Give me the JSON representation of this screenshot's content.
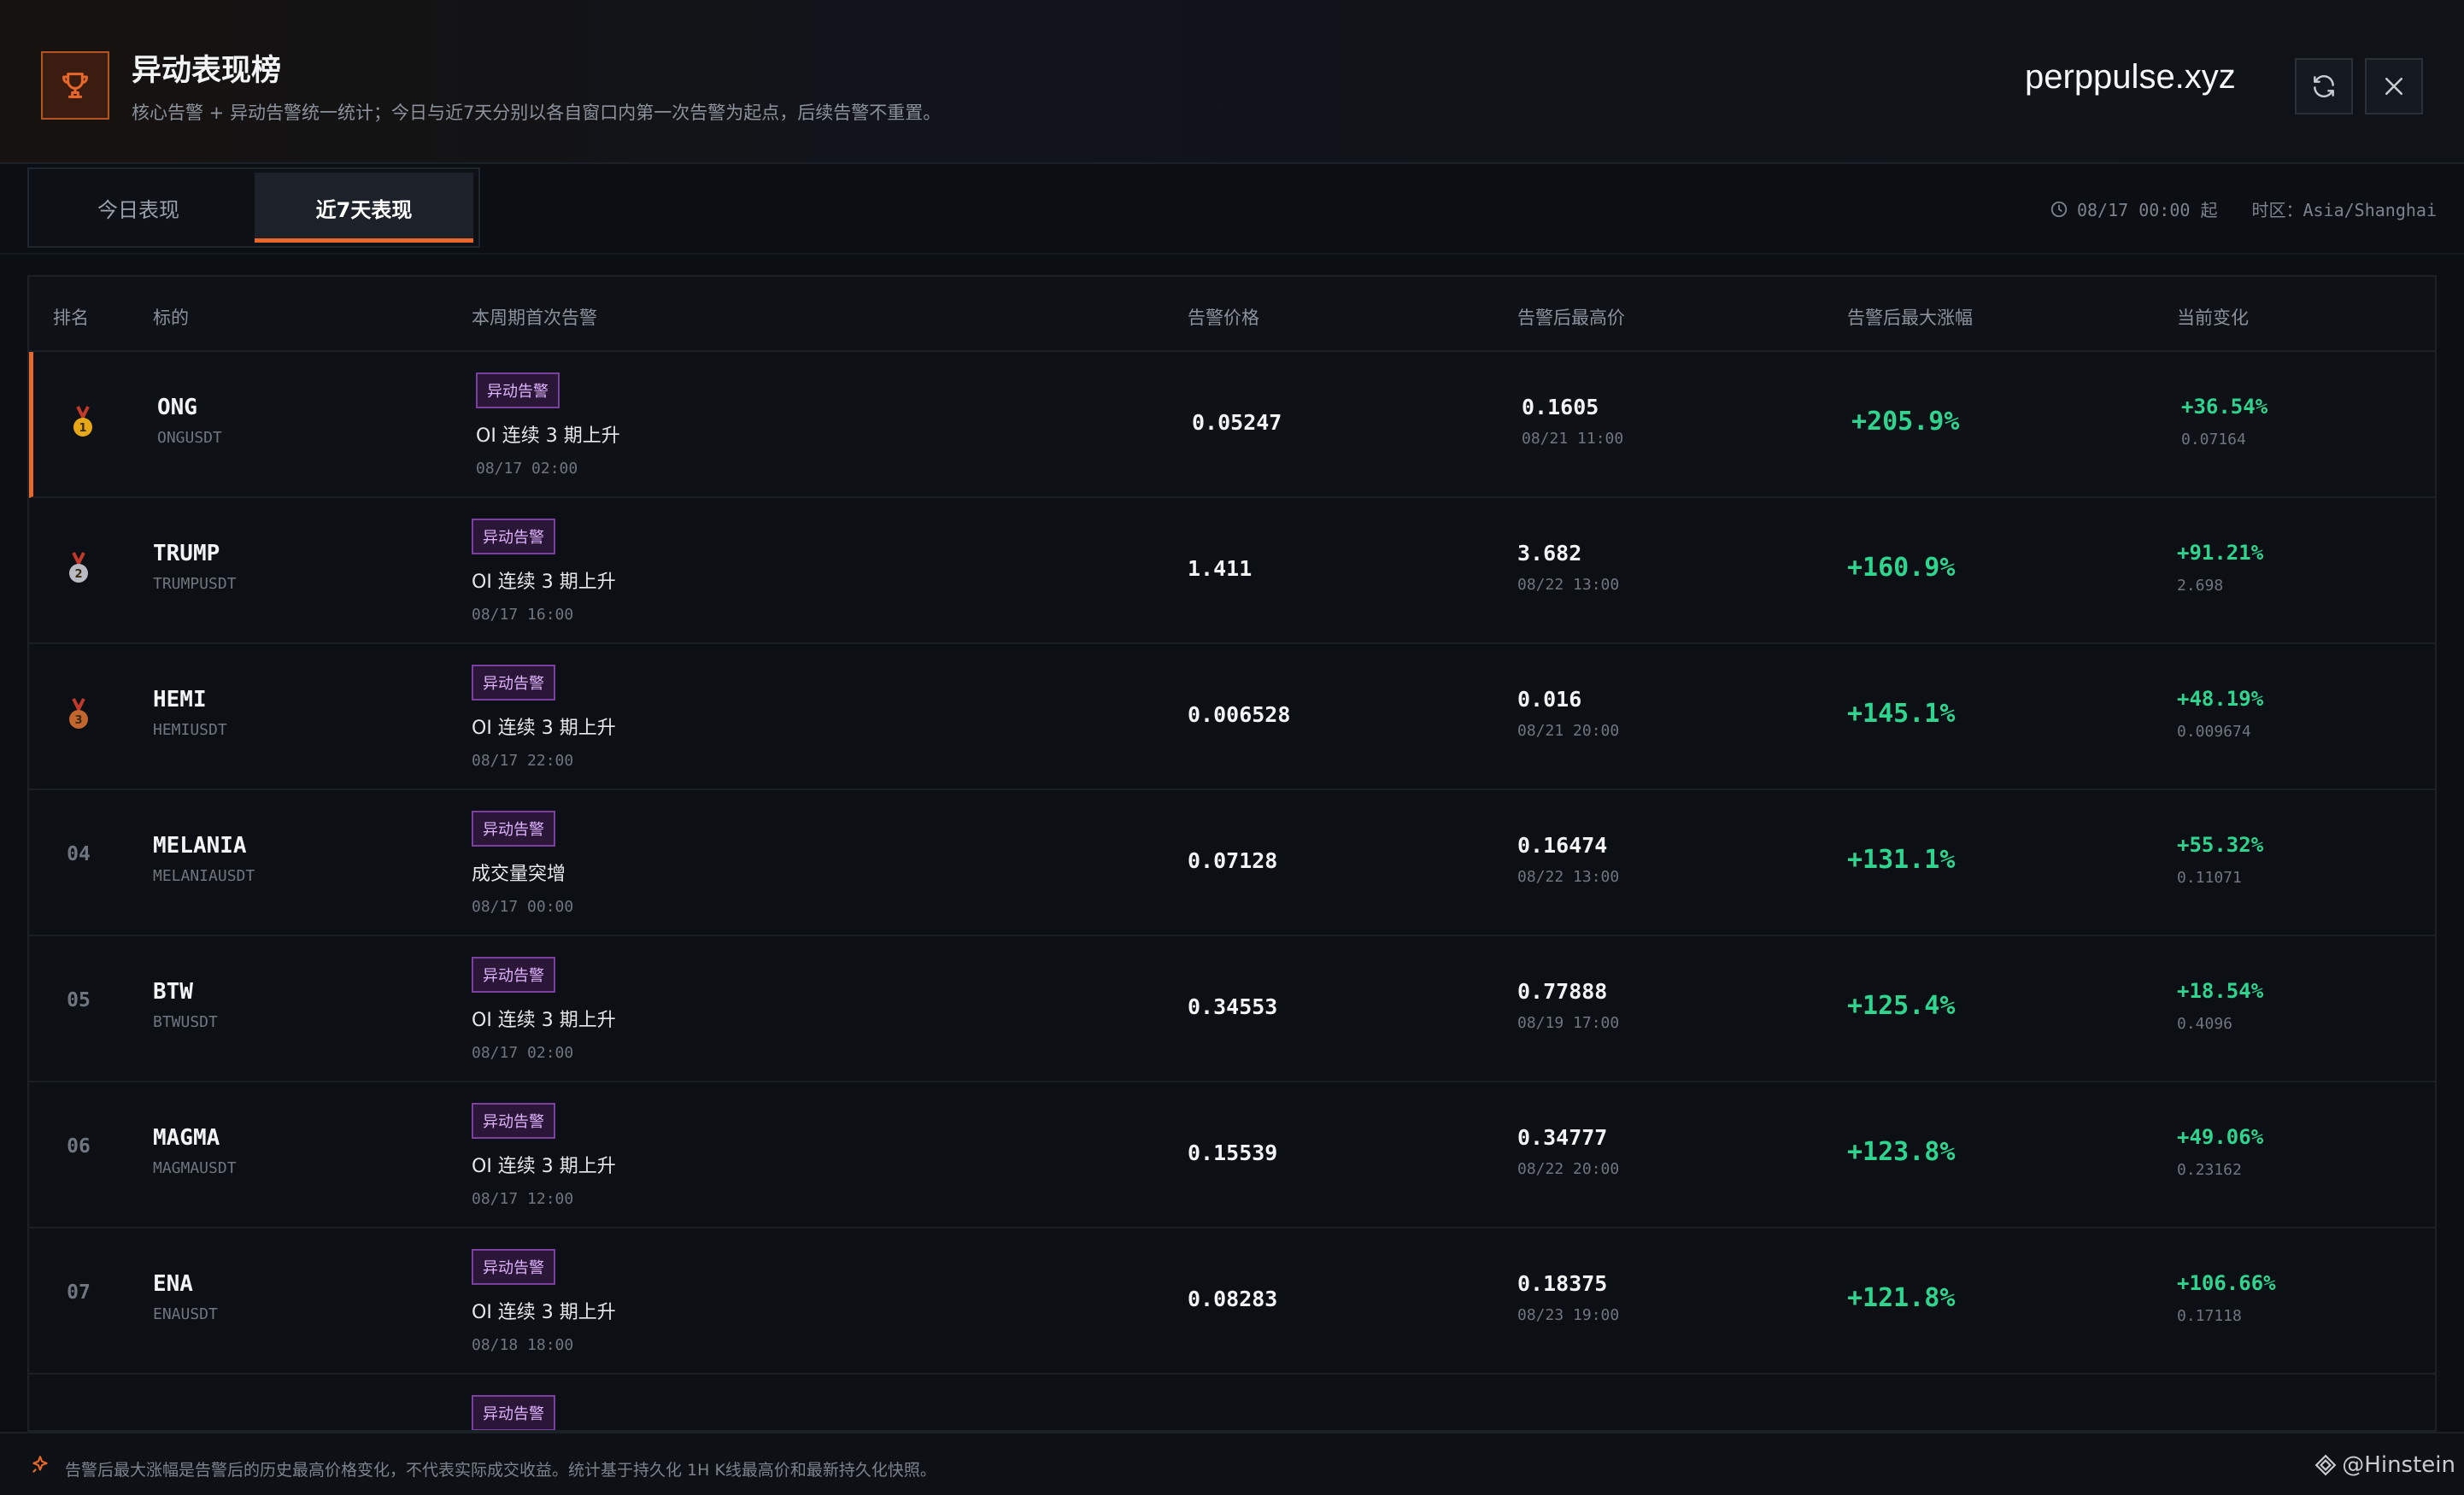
{
  "header": {
    "title": "异动表现榜",
    "subtitle": "核心告警 + 异动告警统一统计；今日与近7天分别以各自窗口内第一次告警为起点，后续告警不重置。",
    "brand": "perppulse.xyz",
    "icons": {
      "trophy": "trophy-icon",
      "refresh": "refresh-icon",
      "close": "close-icon"
    }
  },
  "tabs": [
    {
      "label": "今日表现",
      "active": false
    },
    {
      "label": "近7天表现",
      "active": true
    }
  ],
  "meta": {
    "since": "08/17 00:00 起",
    "timezone": "时区：Asia/Shanghai"
  },
  "columns": [
    "排名",
    "标的",
    "本周期首次告警",
    "告警价格",
    "告警后最高价",
    "告警后最大涨幅",
    "当前变化"
  ],
  "rows": [
    {
      "rank": "",
      "medal": "gold",
      "symbol": "ONG",
      "pair": "ONGUSDT",
      "badge": "异动告警",
      "alert": "OI 连续 3 期上升",
      "alert_time": "08/17 02:00",
      "price": "0.05247",
      "high": "0.1605",
      "high_time": "08/21 11:00",
      "gain": "+205.9%",
      "cur_pct": "+36.54%",
      "cur_px": "0.07164"
    },
    {
      "rank": "",
      "medal": "silver",
      "symbol": "TRUMP",
      "pair": "TRUMPUSDT",
      "badge": "异动告警",
      "alert": "OI 连续 3 期上升",
      "alert_time": "08/17 16:00",
      "price": "1.411",
      "high": "3.682",
      "high_time": "08/22 13:00",
      "gain": "+160.9%",
      "cur_pct": "+91.21%",
      "cur_px": "2.698"
    },
    {
      "rank": "",
      "medal": "bronze",
      "symbol": "HEMI",
      "pair": "HEMIUSDT",
      "badge": "异动告警",
      "alert": "OI 连续 3 期上升",
      "alert_time": "08/17 22:00",
      "price": "0.006528",
      "high": "0.016",
      "high_time": "08/21 20:00",
      "gain": "+145.1%",
      "cur_pct": "+48.19%",
      "cur_px": "0.009674"
    },
    {
      "rank": "04",
      "medal": "",
      "symbol": "MELANIA",
      "pair": "MELANIAUSDT",
      "badge": "异动告警",
      "alert": "成交量突增",
      "alert_time": "08/17 00:00",
      "price": "0.07128",
      "high": "0.16474",
      "high_time": "08/22 13:00",
      "gain": "+131.1%",
      "cur_pct": "+55.32%",
      "cur_px": "0.11071"
    },
    {
      "rank": "05",
      "medal": "",
      "symbol": "BTW",
      "pair": "BTWUSDT",
      "badge": "异动告警",
      "alert": "OI 连续 3 期上升",
      "alert_time": "08/17 02:00",
      "price": "0.34553",
      "high": "0.77888",
      "high_time": "08/19 17:00",
      "gain": "+125.4%",
      "cur_pct": "+18.54%",
      "cur_px": "0.4096"
    },
    {
      "rank": "06",
      "medal": "",
      "symbol": "MAGMA",
      "pair": "MAGMAUSDT",
      "badge": "异动告警",
      "alert": "OI 连续 3 期上升",
      "alert_time": "08/17 12:00",
      "price": "0.15539",
      "high": "0.34777",
      "high_time": "08/22 20:00",
      "gain": "+123.8%",
      "cur_pct": "+49.06%",
      "cur_px": "0.23162"
    },
    {
      "rank": "07",
      "medal": "",
      "symbol": "ENA",
      "pair": "ENAUSDT",
      "badge": "异动告警",
      "alert": "OI 连续 3 期上升",
      "alert_time": "08/18 18:00",
      "price": "0.08283",
      "high": "0.18375",
      "high_time": "08/23 19:00",
      "gain": "+121.8%",
      "cur_pct": "+106.66%",
      "cur_px": "0.17118"
    },
    {
      "rank": "",
      "medal": "",
      "symbol": "",
      "pair": "",
      "badge": "异动告警",
      "alert": "",
      "alert_time": "",
      "price": "",
      "high": "",
      "high_time": "",
      "gain": "",
      "cur_pct": "",
      "cur_px": ""
    }
  ],
  "footer": {
    "note": "告警后最大涨幅是告警后的历史最高价格变化，不代表实际成交收益。统计基于持久化 1H K线最高价和最新持久化快照。",
    "watermark": "@Hinstein"
  },
  "colors": {
    "accent": "#e8672a",
    "positive": "#2fd48f",
    "badge_border": "#7b3fa0",
    "gold": "#e6a817",
    "silver": "#b8bcc2",
    "bronze": "#c2662d"
  }
}
